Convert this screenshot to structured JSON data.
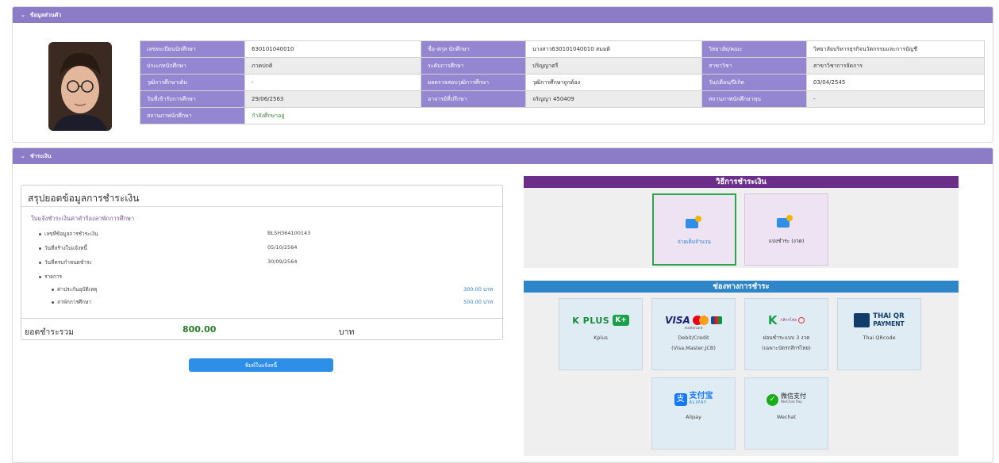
{
  "personal": {
    "header": "ข้อมูลส่วนตัว",
    "rows": [
      [
        {
          "label": "เลขทะเบียนนักศึกษา",
          "value": "630101040010"
        },
        {
          "label": "ชื่อ-สกุล นักศึกษา",
          "value": "นางสาว630101040010 สมมติ"
        },
        {
          "label": "วิทยาลัย/คณะ",
          "value": "วิทยาลัยบริหารธุรกิจนวัตกรรมและการบัญชี"
        }
      ],
      [
        {
          "label": "ประเภทนักศึกษา",
          "value": "ภาคปกติ"
        },
        {
          "label": "ระดับการศึกษา",
          "value": "ปริญญาตรี"
        },
        {
          "label": "สาขาวิชา",
          "value": "สาขาวิชาการจัดการ"
        }
      ],
      [
        {
          "label": "วุฒิการศึกษาเดิม",
          "value": "-"
        },
        {
          "label": "ผลตรวจสอบวุฒิการศึกษา",
          "value": "วุฒิการศึกษาถูกต้อง"
        },
        {
          "label": "วัน/เดือน/ปีเกิด",
          "value": "03/04/2545"
        }
      ],
      [
        {
          "label": "วันที่เข้ารับการศึกษา",
          "value": "29/06/2563"
        },
        {
          "label": "อาจารย์ที่ปรึกษา",
          "value": "จริญญา 450409"
        },
        {
          "label": "สถานภาพนักศึกษาทุน",
          "value": "-"
        }
      ]
    ],
    "status": {
      "label": "สถานภาพนักศึกษา",
      "value": "กำลังศึกษาอยู่"
    }
  },
  "payment": {
    "header": "ชำระเงิน",
    "summary": {
      "title": "สรุปยอดข้อมูลการชำระเงิน",
      "subtitle": "ใบแจ้งชำระเงินค่าคำร้องลาพักการศึกษา",
      "fields": [
        {
          "label": "เลขที่ข้อมูลการชำระเงิน",
          "value": "BLSH364100143"
        },
        {
          "label": "วันที่สร้างใบแจ้งหนี้",
          "value": "05/10/2564"
        },
        {
          "label": "วันที่ครบกำหนดชำระ",
          "value": "30/09/2564"
        }
      ],
      "items_label": "รายการ",
      "items": [
        {
          "label": "ค่าประกันอุบัติเหตุ",
          "amount": "300.00 บาท"
        },
        {
          "label": "ลาพักการศึกษา",
          "amount": "500.00 บาท"
        }
      ],
      "total_label": "ยอดชำระรวม",
      "total_value": "800.00",
      "total_unit": "บาท"
    },
    "print_button": "พิมพ์ใบแจ้งหนี้",
    "methods": {
      "header": "วิธีการชำระเงิน",
      "options": [
        {
          "label": "จ่ายเต็มจำนวน",
          "selected": true
        },
        {
          "label": "แบ่งชำระ (งวด)",
          "selected": false
        }
      ]
    },
    "channels": {
      "header": "ช่องทางการชำระ",
      "kplus": {
        "logo": "K PLUS",
        "logo_badge": "K+",
        "label": "Kplus"
      },
      "card": {
        "logo_visa": "VISA",
        "logo_sub": "mastercard",
        "label1": "Debit/Credit",
        "label2": "(Visa,Master,JCB)"
      },
      "installment": {
        "logo_k": "K",
        "logo_text": "กสิกรไทย",
        "label1": "ผ่อนชำระแบบ 3 งวด",
        "label2": "(เฉพาะบัตรกสิกรไทย)"
      },
      "qr": {
        "logo1": "THAI QR",
        "logo2": "PAYMENT",
        "label": "Thai QRcode"
      },
      "alipay": {
        "logo_zh": "支付宝",
        "logo_en": "ALIPAY",
        "label": "Alipay"
      },
      "wechat": {
        "logo_zh": "微信支付",
        "logo_en": "WeChat Pay",
        "label": "Wechat"
      }
    }
  },
  "colors": {
    "header_purple": "#8c7cc8",
    "label_purple": "#9586d2",
    "method_purple": "#6b2f8a",
    "channel_blue": "#2e86c9",
    "button_blue": "#2f8fe8",
    "total_green": "#2a7a2a"
  }
}
